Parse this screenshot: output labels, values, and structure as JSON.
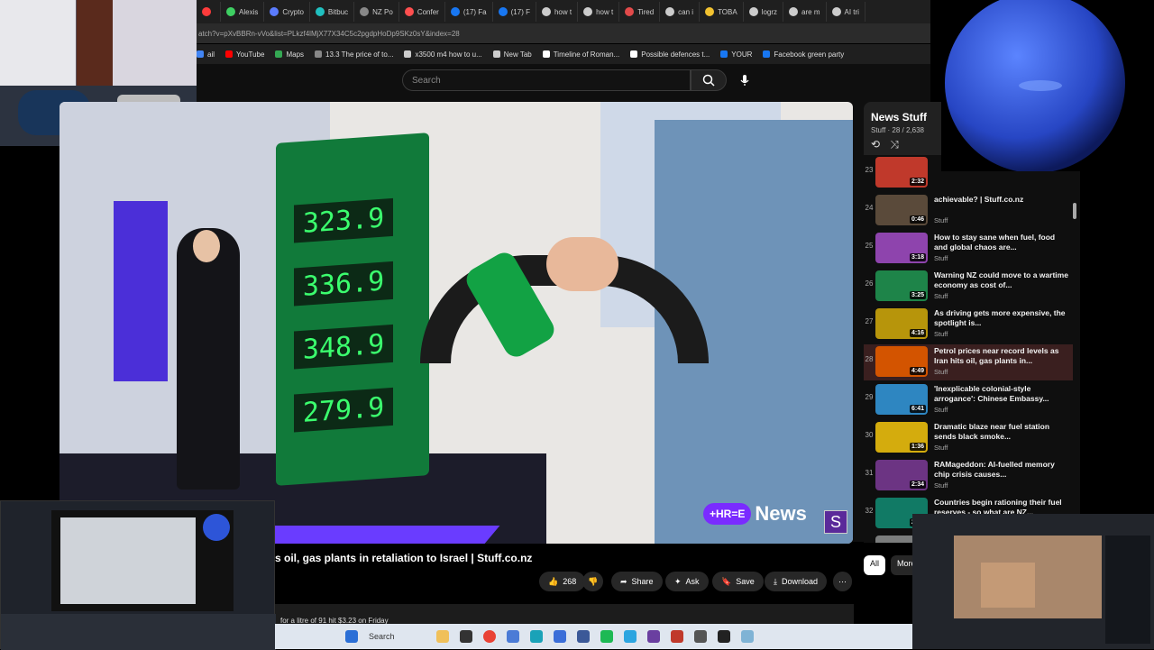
{
  "browser": {
    "tabs": [
      {
        "label": "",
        "color": "#ff3b3b"
      },
      {
        "label": "Alexis",
        "color": "#3ecf62"
      },
      {
        "label": "Crypto",
        "color": "#5b7cff"
      },
      {
        "label": "Bitbuc",
        "color": "#20c0c0"
      },
      {
        "label": "NZ Po",
        "color": "#888888"
      },
      {
        "label": "Confer",
        "color": "#ff4f4f"
      },
      {
        "label": "(17) Fa",
        "color": "#1877f2"
      },
      {
        "label": "(17) F",
        "color": "#1877f2"
      },
      {
        "label": "how t",
        "color": "#cccccc"
      },
      {
        "label": "how t",
        "color": "#cccccc"
      },
      {
        "label": "Tired",
        "color": "#e24a4a"
      },
      {
        "label": "can i",
        "color": "#cccccc"
      },
      {
        "label": "TOBA",
        "color": "#f2c230"
      },
      {
        "label": "logrz",
        "color": "#cccccc"
      },
      {
        "label": "are m",
        "color": "#cccccc"
      },
      {
        "label": "AI tri",
        "color": "#cccccc"
      }
    ],
    "url": "atch?v=pXvBBRn-vVo&list=PLkzf4lMjX77X34C5c2pgdpHoDp9SKz0sY&index=28",
    "bookmarks": [
      {
        "label": "ail",
        "color": "#4285f4"
      },
      {
        "label": "YouTube",
        "color": "#ff0000"
      },
      {
        "label": "Maps",
        "color": "#34a853"
      },
      {
        "label": "13.3 The price of to...",
        "color": "#888888"
      },
      {
        "label": "x3500 m4 how to u...",
        "color": "#cccccc"
      },
      {
        "label": "New Tab",
        "color": "#cccccc"
      },
      {
        "label": "Timeline of Roman...",
        "color": "#ffffff"
      },
      {
        "label": "Possible defences t...",
        "color": "#ffffff"
      },
      {
        "label": "YOUR",
        "color": "#1877f2"
      },
      {
        "label": "Facebook green party",
        "color": "#1877f2"
      }
    ]
  },
  "youtube": {
    "search_placeholder": "Search",
    "video_title": "s oil, gas plants in retaliation to Israel | Stuff.co.nz",
    "like_count": "268",
    "actions": {
      "share": "Share",
      "ask": "Ask",
      "save": "Save",
      "download": "Download"
    },
    "description": "for a litre of 91 hit $3.23 on Friday",
    "news_logo": {
      "three": "+HR=E",
      "news": "News",
      "s": "S"
    },
    "pump_prices": [
      "323.9",
      "336.9",
      "348.9",
      "279.9"
    ],
    "chips": [
      "All",
      "More"
    ]
  },
  "playlist": {
    "title": "News Stuff",
    "subtitle": "Stuff · 28 / 2,638",
    "items": [
      {
        "num": "23",
        "title": "",
        "channel": "",
        "dur": "2:32",
        "color": "#c0392b",
        "active": false
      },
      {
        "num": "24",
        "title": "achievable? | Stuff.co.nz",
        "channel": "Stuff",
        "dur": "0:46",
        "color": "#5a4a3a",
        "active": false
      },
      {
        "num": "25",
        "title": "How to stay sane when fuel, food and global chaos are...",
        "channel": "Stuff",
        "dur": "3:18",
        "color": "#8e44ad",
        "active": false
      },
      {
        "num": "26",
        "title": "Warning NZ could move to a wartime economy as cost of...",
        "channel": "Stuff",
        "dur": "3:25",
        "color": "#1e8449",
        "active": false
      },
      {
        "num": "27",
        "title": "As driving gets more expensive, the spotlight is...",
        "channel": "Stuff",
        "dur": "4:16",
        "color": "#b7950b",
        "active": false
      },
      {
        "num": "28",
        "title": "Petrol prices near record levels as Iran hits oil, gas plants in...",
        "channel": "Stuff",
        "dur": "4:49",
        "color": "#d35400",
        "active": true
      },
      {
        "num": "29",
        "title": "'Inexplicable colonial-style arrogance': Chinese Embassy...",
        "channel": "Stuff",
        "dur": "6:41",
        "color": "#2e86c1",
        "active": false
      },
      {
        "num": "30",
        "title": "Dramatic blaze near fuel station sends black smoke...",
        "channel": "Stuff",
        "dur": "1:36",
        "color": "#d4ac0d",
        "active": false
      },
      {
        "num": "31",
        "title": "RAMageddon: AI-fuelled memory chip crisis causes...",
        "channel": "Stuff",
        "dur": "2:34",
        "color": "#6c3483",
        "active": false
      },
      {
        "num": "32",
        "title": "Countries begin rationing their fuel reserves - so what are NZ...",
        "channel": "Stuff",
        "dur": "2:32",
        "color": "#117a65",
        "active": false
      },
      {
        "num": "33",
        "title": "",
        "channel": "",
        "dur": "",
        "color": "#7b7d7d",
        "active": false
      }
    ]
  },
  "taskbar": {
    "search": "Search"
  }
}
